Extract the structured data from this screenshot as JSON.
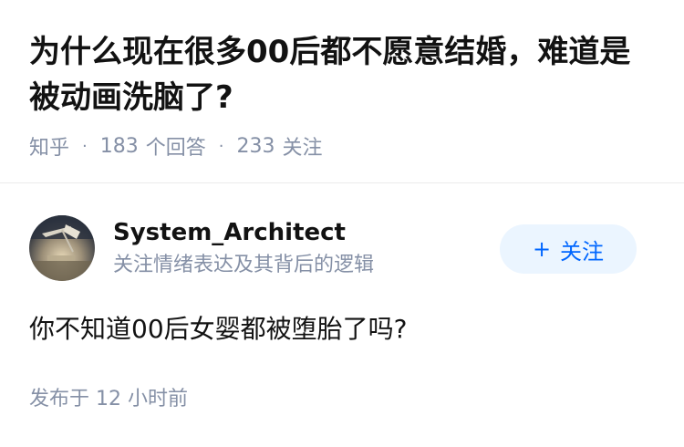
{
  "question": {
    "title": "为什么现在很多00后都不愿意结婚，难道是被动画洗脑了?",
    "source": "知乎",
    "answer_count": "183",
    "answer_label": "个回答",
    "follow_count": "233",
    "follow_label": "关注",
    "separator": "·"
  },
  "author": {
    "name": "System_Architect",
    "bio": "关注情绪表达及其背后的逻辑",
    "follow_button": {
      "plus": "+",
      "label": "关注"
    }
  },
  "answer": {
    "text": "你不知道00后女婴都被堕胎了吗?",
    "published": "发布于 12 小时前"
  },
  "colors": {
    "primary_text": "#121212",
    "secondary_text": "#8590a6",
    "accent": "#0066ff",
    "follow_bg": "#ebf5ff",
    "divider": "#ebebeb"
  },
  "icons": {
    "avatar": "avatar-desk-lamp"
  }
}
